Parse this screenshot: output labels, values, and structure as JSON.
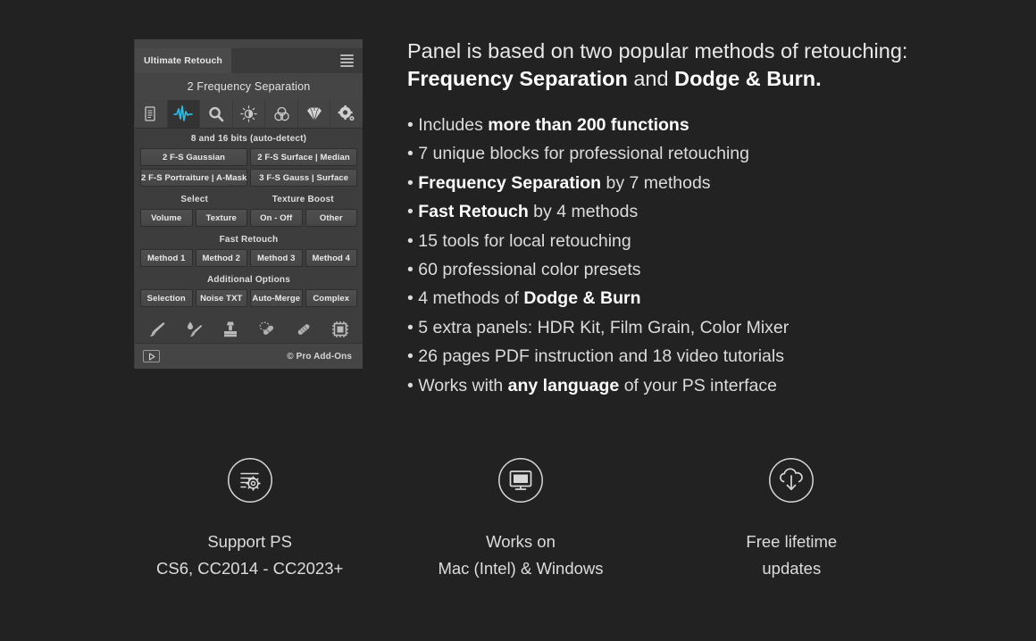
{
  "panel": {
    "tab_label": "Ultimate Retouch",
    "menu_icon": "hamburger-menu-icon",
    "title": "2 Frequency Separation",
    "icon_tabs": [
      {
        "name": "document-icon",
        "active": false
      },
      {
        "name": "waveform-icon",
        "active": true
      },
      {
        "name": "magnifier-icon",
        "active": false
      },
      {
        "name": "brightness-icon",
        "active": false
      },
      {
        "name": "color-circles-icon",
        "active": false
      },
      {
        "name": "diamond-icon",
        "active": false
      },
      {
        "name": "gear-icon",
        "active": false
      }
    ],
    "bits_label": "8 and 16 bits (auto-detect)",
    "fs_buttons_row1": [
      "2 F-S Gaussian",
      "2 F-S Surface | Median"
    ],
    "fs_buttons_row2": [
      "2 F-S Portraiture | A-Mask",
      "3 F-S Gauss | Surface"
    ],
    "select_label": "Select",
    "texture_boost_label": "Texture Boost",
    "select_buttons": [
      "Volume",
      "Texture",
      "On - Off",
      "Other"
    ],
    "fast_retouch_label": "Fast Retouch",
    "fast_retouch_buttons": [
      "Method 1",
      "Method 2",
      "Method 3",
      "Method 4"
    ],
    "additional_options_label": "Additional Options",
    "additional_options_buttons": [
      "Selection",
      "Noise TXT",
      "Auto-Merge",
      "Complex"
    ],
    "tools": [
      "brush-icon",
      "smudge-brush-icon",
      "clone-stamp-icon",
      "spot-healing-brush-icon",
      "healing-brush-icon",
      "chip-mask-icon"
    ],
    "footer": {
      "play_icon": "play-button-icon",
      "copyright": "© Pro Add-Ons"
    }
  },
  "headline": {
    "line1": "Panel is based on two popular methods of retouching:",
    "line2_bold1": "Frequency Separation",
    "line2_mid": " and ",
    "line2_bold2": "Dodge & Burn."
  },
  "bullets": [
    {
      "pre": "• Includes ",
      "bold": "more than 200 functions",
      "post": ""
    },
    {
      "pre": "• 7 unique blocks for professional retouching",
      "bold": "",
      "post": ""
    },
    {
      "pre": "• ",
      "bold": "Frequency Separation",
      "post": " by 7 methods"
    },
    {
      "pre": "• ",
      "bold": "Fast Retouch",
      "post": " by 4 methods"
    },
    {
      "pre": "• 15 tools for local retouching",
      "bold": "",
      "post": ""
    },
    {
      "pre": "• 60 professional color presets",
      "bold": "",
      "post": ""
    },
    {
      "pre": "• 4 methods of ",
      "bold": "Dodge & Burn",
      "post": ""
    },
    {
      "pre": "• 5 extra panels: HDR Kit, Film Grain, Color Mixer",
      "bold": "",
      "post": ""
    },
    {
      "pre": "• 26 pages PDF instruction and 18 video tutorials",
      "bold": "",
      "post": ""
    },
    {
      "pre": "• Works with ",
      "bold": "any language",
      "post": " of your PS interface"
    }
  ],
  "features": [
    {
      "icon": "settings-list-circle-icon",
      "line1": "Support PS",
      "line2": "CS6, CC2014 - CC2023+"
    },
    {
      "icon": "monitor-circle-icon",
      "line1": "Works on",
      "line2": "Mac (Intel) & Windows"
    },
    {
      "icon": "cloud-download-circle-icon",
      "line1": "Free lifetime",
      "line2": "updates"
    }
  ],
  "colors": {
    "background": "#222222",
    "panel_body": "#3d3d3d",
    "panel_header": "#454545",
    "accent_cyan": "#2fb8e0",
    "text_primary": "#e8e8e8",
    "text_secondary": "#dcdcdc"
  }
}
